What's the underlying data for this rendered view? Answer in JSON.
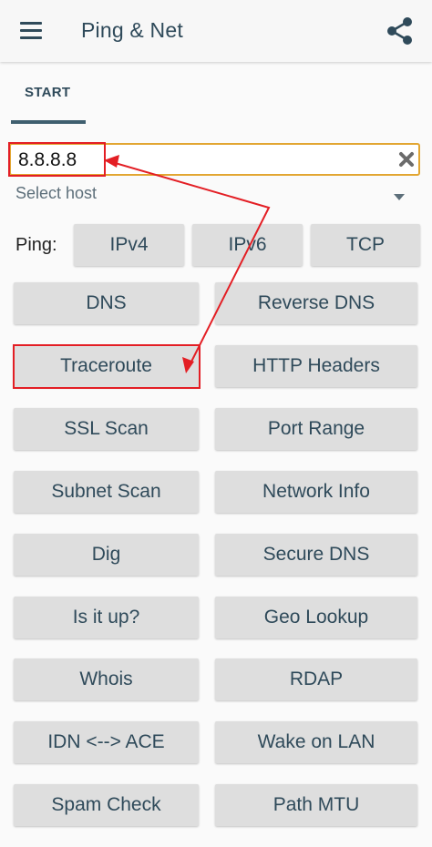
{
  "app": {
    "title": "Ping & Net"
  },
  "icons": {
    "menu": "menu-icon",
    "share": "share-icon",
    "clear": "clear-icon",
    "dropdown": "dropdown-icon"
  },
  "tabs": [
    {
      "label": "START"
    }
  ],
  "host_input": {
    "value": "8.8.8.8",
    "hint": "Select host"
  },
  "ping": {
    "label": "Ping:",
    "buttons": [
      "IPv4",
      "IPv6",
      "TCP"
    ]
  },
  "tools": [
    [
      "DNS",
      "Reverse DNS"
    ],
    [
      "Traceroute",
      "HTTP Headers"
    ],
    [
      "SSL Scan",
      "Port Range"
    ],
    [
      "Subnet Scan",
      "Network Info"
    ],
    [
      "Dig",
      "Secure DNS"
    ],
    [
      "Is it up?",
      "Geo Lookup"
    ],
    [
      "Whois",
      "RDAP"
    ],
    [
      "IDN <--> ACE",
      "Wake on LAN"
    ],
    [
      "Spam Check",
      "Path MTU"
    ]
  ],
  "colors": {
    "accent": "#e2a632",
    "text_primary": "#2f4a5a",
    "button_bg": "#dedede",
    "annotation": "#e31e24"
  }
}
